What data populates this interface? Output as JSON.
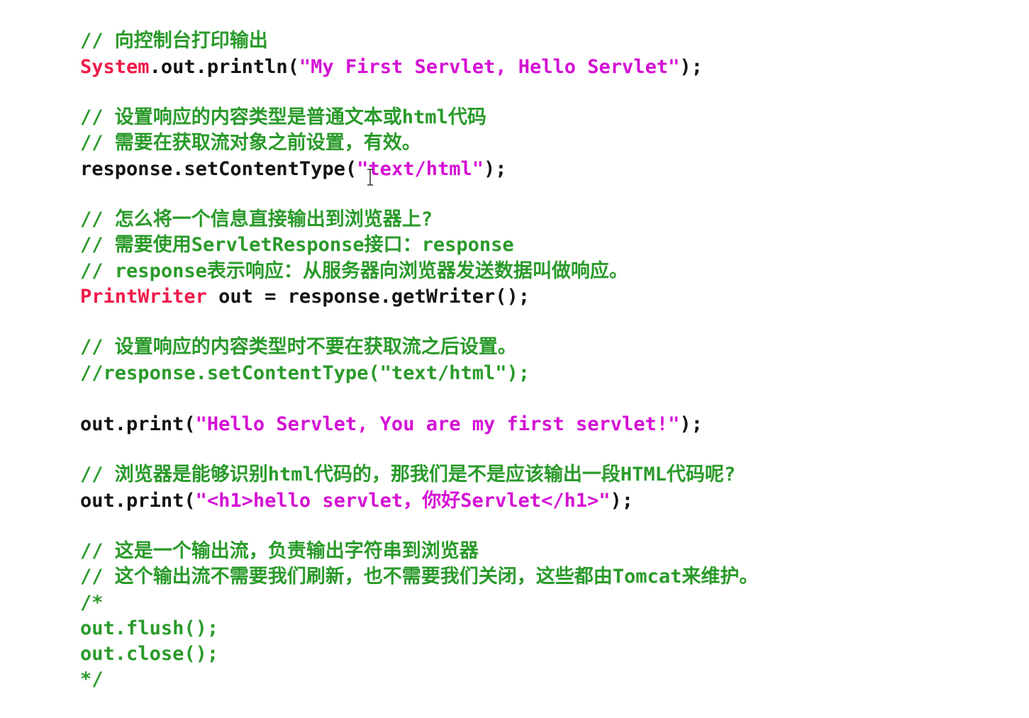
{
  "code": {
    "l1": "// 向控制台打印输出",
    "l2_type": "System",
    "l2_call": ".out.println(",
    "l2_str": "\"My First Servlet, Hello Servlet\"",
    "l2_end": ");",
    "l3": "// 设置响应的内容类型是普通文本或html代码",
    "l4": "// 需要在获取流对象之前设置，有效。",
    "l5_call": "response.setContentType(",
    "l5_str": "\"text/html\"",
    "l5_end": ");",
    "l6": "// 怎么将一个信息直接输出到浏览器上?",
    "l7": "// 需要使用ServletResponse接口：response",
    "l8": "// response表示响应：从服务器向浏览器发送数据叫做响应。",
    "l9_type": "PrintWriter",
    "l9_rest": " out = response.getWriter();",
    "l10": "// 设置响应的内容类型时不要在获取流之后设置。",
    "l11": "//response.setContentType(\"text/html\");",
    "l12_call": "out.print(",
    "l12_str": "\"Hello Servlet, You are my first servlet!\"",
    "l12_end": ");",
    "l13": "// 浏览器是能够识别html代码的，那我们是不是应该输出一段HTML代码呢?",
    "l14_call": "out.print(",
    "l14_str": "\"<h1>hello servlet，你好Servlet</h1>\"",
    "l14_end": ");",
    "l15": "// 这是一个输出流，负责输出字符串到浏览器",
    "l16": "// 这个输出流不需要我们刷新，也不需要我们关闭，这些都由Tomcat来维护。",
    "l17": "/*",
    "l18": "out.flush();",
    "l19": "out.close();",
    "l20": "*/"
  },
  "colors": {
    "comment": "#2a9a2a",
    "keyword": "#ee1c4a",
    "string": "#d412d4",
    "plain": "#141414"
  },
  "icons": {
    "text_cursor": "I-beam"
  }
}
